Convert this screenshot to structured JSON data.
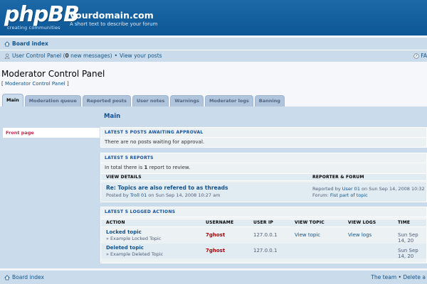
{
  "header": {
    "logo_text": "phpBB",
    "logo_tagline": "creating communities",
    "site_name": "yourdomain.com",
    "site_description": "A short text to describe your forum"
  },
  "nav": {
    "board_index": "Board index",
    "ucp_label": "User Control Panel (",
    "new_messages_count": "0",
    "new_messages_text": "new messages)",
    "separator": "•",
    "view_posts": "View your posts",
    "faq": "FA"
  },
  "page": {
    "title": "Moderator Control Panel",
    "breadcrumb_open": "[",
    "breadcrumb_link": "Moderator Control Panel",
    "breadcrumb_close": "]"
  },
  "tabs": [
    {
      "label": "Main",
      "active": true
    },
    {
      "label": "Moderation queue",
      "active": false
    },
    {
      "label": "Reported posts",
      "active": false
    },
    {
      "label": "User notes",
      "active": false
    },
    {
      "label": "Warnings",
      "active": false
    },
    {
      "label": "Moderator logs",
      "active": false
    },
    {
      "label": "Banning",
      "active": false
    }
  ],
  "sidebar": {
    "items": [
      {
        "label": "Front page"
      }
    ]
  },
  "main": {
    "title": "Main",
    "awaiting": {
      "heading": "LATEST 5 POSTS AWAITING APPROVAL",
      "text": "There are no posts waiting for approval."
    },
    "reports": {
      "heading": "LATEST 5 REPORTS",
      "summary_pre": "In total there is",
      "summary_count": "1",
      "summary_post": "report to review.",
      "col_details": "VIEW DETAILS",
      "col_reporter": "REPORTER & FORUM",
      "rows": [
        {
          "title": "Re: Topics are also refered to as threads",
          "posted_pre": "Posted by",
          "posted_user": "Troll 01",
          "posted_date": "on Sun Sep 14, 2008 10:27 am",
          "reported_pre": "Reported by",
          "reported_user": "User 01",
          "reported_date": "on Sun Sep 14, 2008 10:32",
          "forum_pre": "Forum:",
          "forum_name": "Fist part of topic"
        }
      ]
    },
    "logs": {
      "heading": "LATEST 5 LOGGED ACTIONS",
      "columns": [
        "ACTION",
        "USERNAME",
        "USER IP",
        "VIEW TOPIC",
        "VIEW LOGS",
        "TIME"
      ],
      "rows": [
        {
          "action": "Locked topic",
          "detail": "» Example Locked Topic",
          "username": "7ghost",
          "ip": "127.0.0.1",
          "view_topic": "View topic",
          "view_logs": "View logs",
          "time": "Sun Sep 14, 20"
        },
        {
          "action": "Deleted topic",
          "detail": "» Example Deleted Topic",
          "username": "7ghost",
          "ip": "127.0.0.1",
          "view_topic": "",
          "view_logs": "",
          "time": "Sun Sep 14, 20"
        }
      ]
    }
  },
  "footer": {
    "board_index": "Board index",
    "team": "The team",
    "separator": "•",
    "delete": "Delete a"
  },
  "colors": {
    "header_blue": "#0c5796",
    "nav_bg": "#cadceb",
    "link": "#105289",
    "username_red": "#aa0000",
    "sidebar_active": "#bc2a4d"
  }
}
